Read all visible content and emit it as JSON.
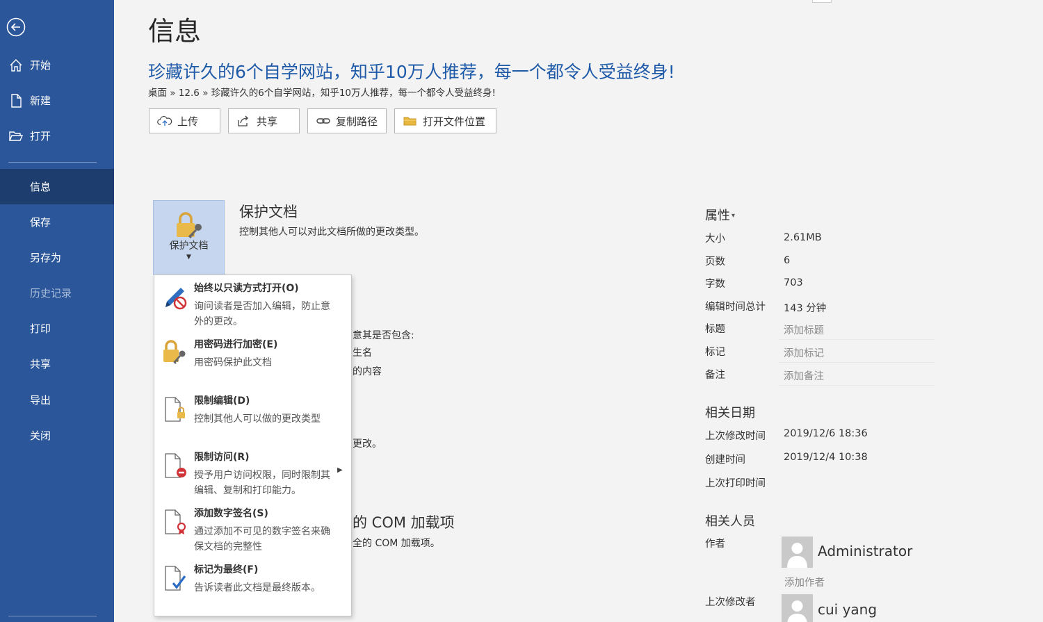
{
  "sidebar": {
    "items": [
      {
        "label": "开始"
      },
      {
        "label": "新建"
      },
      {
        "label": "打开"
      },
      {
        "label": "信息"
      },
      {
        "label": "保存"
      },
      {
        "label": "另存为"
      },
      {
        "label": "历史记录"
      },
      {
        "label": "打印"
      },
      {
        "label": "共享"
      },
      {
        "label": "导出"
      },
      {
        "label": "关闭"
      }
    ]
  },
  "header": {
    "title": "信息",
    "doc_title": "珍藏许久的6个自学网站，知乎10万人推荐，每一个都令人受益终身!",
    "breadcrumb": "桌面 » 12.6 » 珍藏许久的6个自学网站，知乎10万人推荐，每一个都令人受益终身!"
  },
  "toolbar": {
    "upload": "上传",
    "share": "共享",
    "copy_path": "复制路径",
    "open_location": "打开文件位置"
  },
  "protect": {
    "tile_label": "保护文档",
    "title": "保护文档",
    "desc": "控制其他人可以对此文档所做的更改类型。"
  },
  "background_partial": {
    "line1": "意其是否包含:",
    "line2": "生名",
    "line3": "的内容",
    "line4": "更改。",
    "com_title": "的 COM 加载项",
    "com_desc": "全的 COM 加载项。"
  },
  "menu": {
    "items": [
      {
        "title": "始终以只读方式打开(O)",
        "desc": "询问读者是否加入编辑，防止意外的更改。"
      },
      {
        "title": "用密码进行加密(E)",
        "desc": "用密码保护此文档"
      },
      {
        "title": "限制编辑(D)",
        "desc": "控制其他人可以做的更改类型"
      },
      {
        "title": "限制访问(R)",
        "desc": "授予用户访问权限，同时限制其编辑、复制和打印能力。"
      },
      {
        "title": "添加数字签名(S)",
        "desc": "通过添加不可见的数字签名来确保文档的完整性"
      },
      {
        "title": "标记为最终(F)",
        "desc": "告诉读者此文档是最终版本。"
      }
    ]
  },
  "properties": {
    "heading": "属性",
    "rows": [
      {
        "label": "大小",
        "value": "2.61MB"
      },
      {
        "label": "页数",
        "value": "6"
      },
      {
        "label": "字数",
        "value": "703"
      },
      {
        "label": "编辑时间总计",
        "value": "143 分钟"
      },
      {
        "label": "标题",
        "value": "添加标题"
      },
      {
        "label": "标记",
        "value": "添加标记"
      },
      {
        "label": "备注",
        "value": "添加备注"
      }
    ]
  },
  "dates": {
    "heading": "相关日期",
    "rows": [
      {
        "label": "上次修改时间",
        "value": "2019/12/6 18:36"
      },
      {
        "label": "创建时间",
        "value": "2019/12/4 10:38"
      },
      {
        "label": "上次打印时间",
        "value": ""
      }
    ]
  },
  "people": {
    "heading": "相关人员",
    "author_label": "作者",
    "author_name": "Administrator",
    "add_author": "添加作者",
    "last_modified_label": "上次修改者",
    "last_modified_name": "cui yang"
  },
  "colors": {
    "sidebar": "#2b579a",
    "sidebar_active": "#1d3d6e",
    "doc_title": "#1e5aa8",
    "tile": "#c6d6ee"
  }
}
